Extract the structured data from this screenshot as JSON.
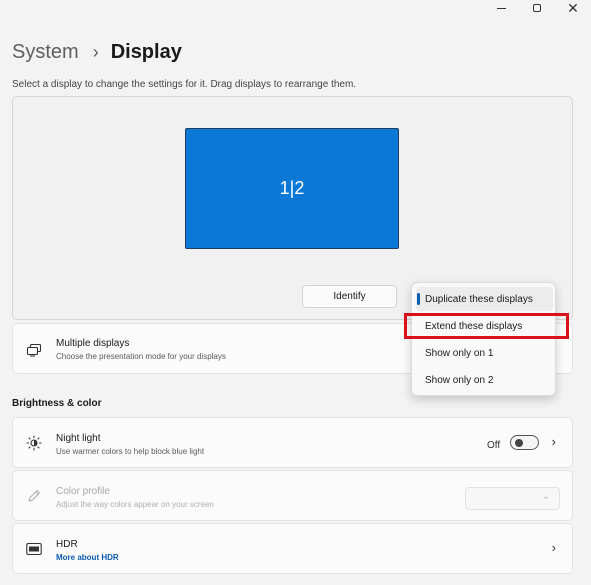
{
  "window": {
    "controls": {
      "minimize": "minimize",
      "maximize": "maximize",
      "close": "✕"
    }
  },
  "header": {
    "parent": "System",
    "separator": "›",
    "current": "Display"
  },
  "instructions": "Select a display to change the settings for it. Drag displays to rearrange them.",
  "arrangement": {
    "monitor_label": "1|2",
    "identify_label": "Identify"
  },
  "multiple_displays": {
    "title": "Multiple displays",
    "subtitle": "Choose the presentation mode for your displays"
  },
  "presentation_menu": {
    "items": [
      {
        "label": "Duplicate these displays",
        "selected": true
      },
      {
        "label": "Extend these displays",
        "selected": false,
        "highlighted": true
      },
      {
        "label": "Show only on 1",
        "selected": false
      },
      {
        "label": "Show only on 2",
        "selected": false
      }
    ]
  },
  "brightness_section": {
    "title": "Brightness & color"
  },
  "night_light": {
    "title": "Night light",
    "subtitle": "Use warmer colors to help block blue light",
    "toggle_state": "Off"
  },
  "color_profile": {
    "title": "Color profile",
    "subtitle": "Adjust the way colors appear on your screen",
    "disabled": true
  },
  "hdr": {
    "title": "HDR",
    "link": "More about HDR"
  },
  "colors": {
    "monitor": "#0a78d4",
    "accent": "#0a5fb4",
    "highlight": "#d7121a"
  },
  "icons": {
    "multiple_displays": "multiple-displays-icon",
    "night_light": "sun-icon",
    "color_profile": "pen-icon",
    "hdr": "hdr-icon",
    "chevron": "chevron-right-icon"
  }
}
